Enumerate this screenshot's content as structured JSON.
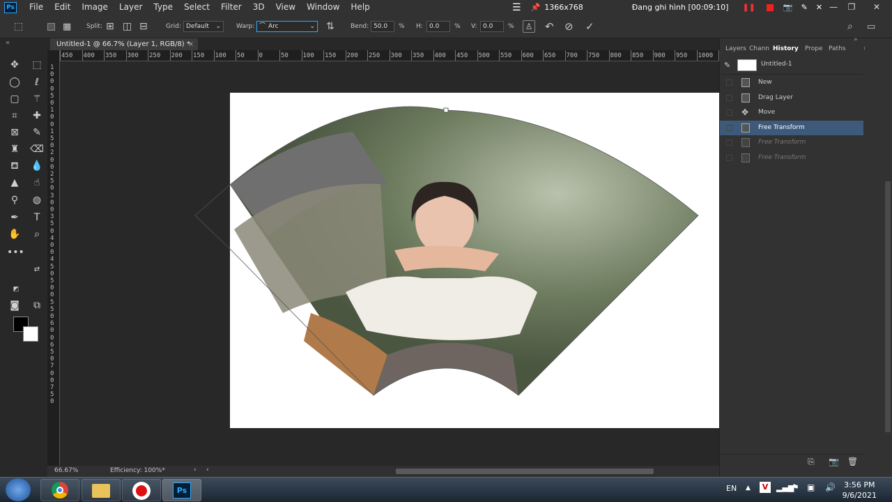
{
  "app": {
    "logo": "Ps"
  },
  "menu": [
    "File",
    "Edit",
    "Image",
    "Layer",
    "Type",
    "Select",
    "Filter",
    "3D",
    "View",
    "Window",
    "Help"
  ],
  "recorder": {
    "resolution": "1366x768",
    "status": "Đang ghi hình [00:09:10]"
  },
  "options": {
    "split_label": "Split:",
    "grid_label": "Grid:",
    "grid_value": "Default",
    "warp_label": "Warp:",
    "warp_value": "Arc",
    "bend_label": "Bend:",
    "bend_value": "50.0",
    "h_label": "H:",
    "h_value": "0.0",
    "v_label": "V:",
    "v_value": "0.0",
    "pct": "%"
  },
  "document": {
    "tab_title": "Untitled-1 @ 66.7% (Layer 1, RGB/8) *",
    "close": "×"
  },
  "ruler_h": [
    "450",
    "400",
    "350",
    "300",
    "250",
    "200",
    "150",
    "100",
    "50",
    "0",
    "50",
    "100",
    "150",
    "200",
    "250",
    "300",
    "350",
    "400",
    "450",
    "500",
    "550",
    "600",
    "650",
    "700",
    "750",
    "800",
    "850",
    "900",
    "950",
    "1000",
    "1050"
  ],
  "ruler_v": [
    "1",
    "0",
    "0",
    "0",
    "5",
    "0",
    "1",
    "0",
    "0",
    "1",
    "5",
    "0",
    "2",
    "0",
    "0",
    "2",
    "5",
    "0",
    "3",
    "0",
    "0",
    "3",
    "5",
    "0",
    "4",
    "0",
    "0",
    "4",
    "5",
    "0",
    "5",
    "0",
    "0",
    "5",
    "5",
    "0",
    "6",
    "0",
    "0",
    "6",
    "5",
    "0",
    "7",
    "0",
    "0",
    "7",
    "5",
    "0"
  ],
  "status": {
    "zoom": "66.67%",
    "efficiency": "Efficiency: 100%*"
  },
  "panel": {
    "tabs": [
      "Layers",
      "Chann",
      "History",
      "Prope",
      "Paths"
    ],
    "snapshot": "Untitled-1",
    "history": [
      {
        "label": "New",
        "state": "normal"
      },
      {
        "label": "Drag Layer",
        "state": "normal"
      },
      {
        "label": "Move",
        "state": "normal"
      },
      {
        "label": "Free Transform",
        "state": "selected"
      },
      {
        "label": "Free Transform",
        "state": "dimmed"
      },
      {
        "label": "Free Transform",
        "state": "dimmed"
      }
    ]
  },
  "taskbar": {
    "lang": "EN",
    "time": "3:56 PM",
    "date": "9/6/2021"
  },
  "colors": {
    "accent": "#31a8ff",
    "selected_row": "#3e5a7a",
    "canvas_bg": "#282828",
    "panel_bg": "#323232"
  }
}
